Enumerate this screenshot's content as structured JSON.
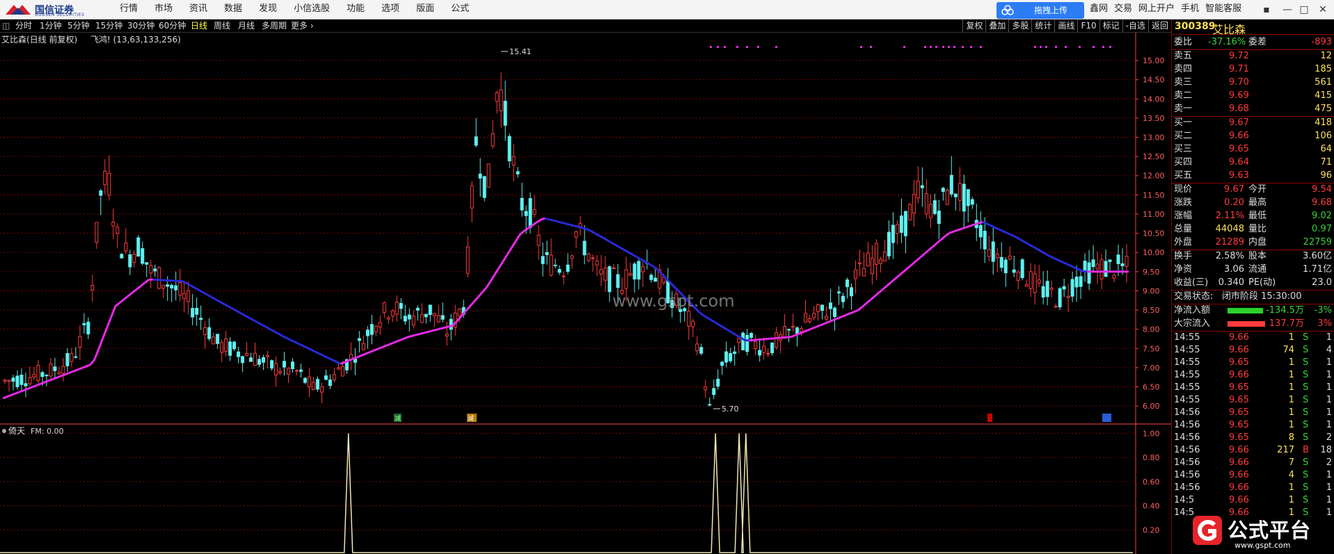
{
  "app": {
    "logo_name": "国信证券",
    "logo_sub": "GUOSEN SECURITIES",
    "menu": [
      "行情",
      "市场",
      "资讯",
      "数据",
      "发现",
      "小信选股",
      "功能",
      "选项",
      "版面",
      "公式"
    ],
    "upload_label": "拖拽上传",
    "right_menu": [
      "鑫网",
      "交易",
      "网上开户",
      "手机",
      "智能客服"
    ],
    "window_buttons": [
      "▪",
      "—",
      "□",
      "✕"
    ]
  },
  "period_bar": {
    "items": [
      "分时",
      "1分钟",
      "5分钟",
      "15分钟",
      "30分钟",
      "60分钟",
      "日线",
      "周线",
      "月线",
      "多周期",
      "更多 ›"
    ],
    "active": "日线",
    "tools": [
      "复权",
      "叠加",
      "多股",
      "统计",
      "画线",
      "F10",
      "标记",
      "-自选",
      "返回"
    ]
  },
  "chart_header": {
    "title": "艾比森(日线 前复权)",
    "indicator": "飞鸿! (13,63,133,256)",
    "sub_title": "倚天",
    "sub_value": "FM: 0.00",
    "high_label": "15.41",
    "low_label": "5.70",
    "watermark": "www.gspt.com",
    "markers": [
      "减",
      "減",
      "",
      ""
    ]
  },
  "colors": {
    "up": "#ff3b3b",
    "down": "#5ff0f0",
    "ma_rise": "#e62be6",
    "ma_fall": "#2a2ad8",
    "grid": "#7a0000",
    "axis": "#ff4040",
    "fm_line": "#f0e6b0"
  },
  "chart_data": {
    "type": "candlestick",
    "y_ticks": [
      "15.00",
      "14.50",
      "14.00",
      "13.50",
      "13.00",
      "12.50",
      "12.00",
      "11.50",
      "11.00",
      "10.50",
      "10.00",
      "9.50",
      "9.00",
      "8.50",
      "8.00",
      "7.50",
      "7.00",
      "6.50",
      "6.00"
    ],
    "ylim": [
      5.55,
      15.58
    ],
    "sub_y_ticks": [
      "1.00",
      "0.80",
      "0.60",
      "0.40",
      "0.20"
    ],
    "sub_ylim": [
      0,
      1.06
    ],
    "fm_spikes": [
      {
        "at": 0.307,
        "value": 1.0
      },
      {
        "at": 0.633,
        "value": 1.0
      },
      {
        "at": 0.654,
        "value": 1.0
      },
      {
        "at": 0.66,
        "value": 1.0
      }
    ],
    "keypoints": [
      [
        0,
        6.65
      ],
      [
        0.02,
        6.75
      ],
      [
        0.04,
        6.9
      ],
      [
        0.06,
        7.2
      ],
      [
        0.075,
        8.2
      ],
      [
        0.085,
        11.5
      ],
      [
        0.092,
        12.0
      ],
      [
        0.1,
        10.4
      ],
      [
        0.11,
        9.9
      ],
      [
        0.12,
        10.2
      ],
      [
        0.13,
        9.5
      ],
      [
        0.15,
        9.1
      ],
      [
        0.17,
        8.5
      ],
      [
        0.19,
        7.6
      ],
      [
        0.22,
        7.3
      ],
      [
        0.24,
        7.0
      ],
      [
        0.26,
        6.9
      ],
      [
        0.275,
        6.45
      ],
      [
        0.29,
        6.7
      ],
      [
        0.31,
        7.3
      ],
      [
        0.33,
        8.2
      ],
      [
        0.345,
        8.6
      ],
      [
        0.36,
        8.3
      ],
      [
        0.38,
        8.5
      ],
      [
        0.395,
        7.9
      ],
      [
        0.41,
        8.7
      ],
      [
        0.42,
        12.9
      ],
      [
        0.43,
        11.5
      ],
      [
        0.44,
        14.6
      ],
      [
        0.45,
        12.8
      ],
      [
        0.46,
        11.3
      ],
      [
        0.47,
        11.0
      ],
      [
        0.48,
        9.8
      ],
      [
        0.5,
        9.6
      ],
      [
        0.51,
        10.6
      ],
      [
        0.53,
        9.4
      ],
      [
        0.55,
        9.2
      ],
      [
        0.57,
        9.8
      ],
      [
        0.59,
        9.0
      ],
      [
        0.61,
        8.2
      ],
      [
        0.62,
        7.5
      ],
      [
        0.628,
        5.9
      ],
      [
        0.64,
        7.1
      ],
      [
        0.66,
        7.7
      ],
      [
        0.68,
        7.5
      ],
      [
        0.7,
        7.9
      ],
      [
        0.72,
        8.3
      ],
      [
        0.74,
        8.6
      ],
      [
        0.76,
        9.4
      ],
      [
        0.78,
        10.0
      ],
      [
        0.8,
        10.6
      ],
      [
        0.815,
        11.6
      ],
      [
        0.83,
        11.0
      ],
      [
        0.845,
        11.8
      ],
      [
        0.86,
        11.2
      ],
      [
        0.88,
        10.0
      ],
      [
        0.9,
        9.7
      ],
      [
        0.92,
        9.1
      ],
      [
        0.94,
        8.8
      ],
      [
        0.955,
        9.3
      ],
      [
        0.97,
        9.6
      ],
      [
        1.0,
        9.6
      ]
    ],
    "ma_keypoints": [
      [
        0,
        6.2
      ],
      [
        0.08,
        7.1
      ],
      [
        0.1,
        8.6
      ],
      [
        0.13,
        9.3
      ],
      [
        0.16,
        9.25
      ],
      [
        0.2,
        8.6
      ],
      [
        0.25,
        7.8
      ],
      [
        0.3,
        7.1
      ],
      [
        0.36,
        7.8
      ],
      [
        0.4,
        8.1
      ],
      [
        0.43,
        9.1
      ],
      [
        0.46,
        10.5
      ],
      [
        0.48,
        10.9
      ],
      [
        0.52,
        10.6
      ],
      [
        0.58,
        9.6
      ],
      [
        0.62,
        8.4
      ],
      [
        0.66,
        7.7
      ],
      [
        0.7,
        7.8
      ],
      [
        0.76,
        8.5
      ],
      [
        0.8,
        9.5
      ],
      [
        0.84,
        10.5
      ],
      [
        0.87,
        10.8
      ],
      [
        0.9,
        10.4
      ],
      [
        0.93,
        9.9
      ],
      [
        0.96,
        9.5
      ],
      [
        1.0,
        9.5
      ]
    ]
  },
  "quote": {
    "code": "300389",
    "name": "艾比森",
    "weibi_label": "委比",
    "weibi_value": "-37.16%",
    "weicha_label": "委差",
    "weicha_value": "-893",
    "sell": [
      {
        "label": "卖五",
        "price": "9.72",
        "vol": "12"
      },
      {
        "label": "卖四",
        "price": "9.71",
        "vol": "185"
      },
      {
        "label": "卖三",
        "price": "9.70",
        "vol": "561"
      },
      {
        "label": "卖二",
        "price": "9.69",
        "vol": "415"
      },
      {
        "label": "卖一",
        "price": "9.68",
        "vol": "475"
      }
    ],
    "buy": [
      {
        "label": "买一",
        "price": "9.67",
        "vol": "418"
      },
      {
        "label": "买二",
        "price": "9.66",
        "vol": "106"
      },
      {
        "label": "买三",
        "price": "9.65",
        "vol": "64"
      },
      {
        "label": "买四",
        "price": "9.64",
        "vol": "71"
      },
      {
        "label": "买五",
        "price": "9.63",
        "vol": "96"
      }
    ],
    "stats": [
      {
        "l1": "现价",
        "v1": "9.67",
        "c1": "red",
        "l2": "今开",
        "v2": "9.54",
        "c2": "red"
      },
      {
        "l1": "涨跌",
        "v1": "0.20",
        "c1": "red",
        "l2": "最高",
        "v2": "9.68",
        "c2": "red"
      },
      {
        "l1": "涨幅",
        "v1": "2.11%",
        "c1": "red",
        "l2": "最低",
        "v2": "9.02",
        "c2": "green"
      },
      {
        "l1": "总量",
        "v1": "44048",
        "c1": "yellow",
        "l2": "量比",
        "v2": "0.97",
        "c2": "green"
      },
      {
        "l1": "外盘",
        "v1": "21289",
        "c1": "red",
        "l2": "内盘",
        "v2": "22759",
        "c2": "green"
      }
    ],
    "stats2": [
      {
        "l1": "换手",
        "v1": "2.58%",
        "l2": "股本",
        "v2": "3.60亿"
      },
      {
        "l1": "净资",
        "v1": "3.06",
        "l2": "流通",
        "v2": "1.71亿"
      },
      {
        "l1": "收益(三)",
        "v1": "0.340",
        "l2": "PE(动)",
        "v2": "23.0"
      }
    ],
    "trade_status_label": "交易状态:",
    "trade_status_value": "闭市阶段 15:30:00",
    "flows": [
      {
        "label": "净流入额",
        "value": "-134.5万",
        "pct": "-3%",
        "color": "green",
        "bar": 0.85
      },
      {
        "label": "大宗流入",
        "value": "137.7万",
        "pct": "3%",
        "color": "red",
        "bar": 0.9
      }
    ],
    "ticks": [
      {
        "t": "14:55",
        "p": "9.66",
        "v": "1",
        "s": "S",
        "n": "1"
      },
      {
        "t": "14:55",
        "p": "9.66",
        "v": "74",
        "s": "S",
        "n": "4"
      },
      {
        "t": "14:55",
        "p": "9.65",
        "v": "1",
        "s": "S",
        "n": "1"
      },
      {
        "t": "14:55",
        "p": "9.66",
        "v": "1",
        "s": "S",
        "n": "1"
      },
      {
        "t": "14:55",
        "p": "9.65",
        "v": "1",
        "s": "S",
        "n": "1"
      },
      {
        "t": "14:55",
        "p": "9.65",
        "v": "1",
        "s": "S",
        "n": "1"
      },
      {
        "t": "14:56",
        "p": "9.65",
        "v": "1",
        "s": "S",
        "n": "1"
      },
      {
        "t": "14:56",
        "p": "9.65",
        "v": "1",
        "s": "S",
        "n": "1"
      },
      {
        "t": "14:56",
        "p": "9.65",
        "v": "8",
        "s": "S",
        "n": "2"
      },
      {
        "t": "14:56",
        "p": "9.66",
        "v": "217",
        "s": "B",
        "n": "18"
      },
      {
        "t": "14:56",
        "p": "9.66",
        "v": "7",
        "s": "S",
        "n": "2"
      },
      {
        "t": "14:56",
        "p": "9.66",
        "v": "4",
        "s": "S",
        "n": "1"
      },
      {
        "t": "14:56",
        "p": "9.66",
        "v": "1",
        "s": "S",
        "n": "1"
      },
      {
        "t": "14:5",
        "p": "9.66",
        "v": "1",
        "s": "S",
        "n": "1"
      },
      {
        "t": "14:5",
        "p": "9.66",
        "v": "1",
        "s": "S",
        "n": "1"
      }
    ]
  },
  "watermark": {
    "brand": "公式平台",
    "url": "www.gspt.com"
  }
}
